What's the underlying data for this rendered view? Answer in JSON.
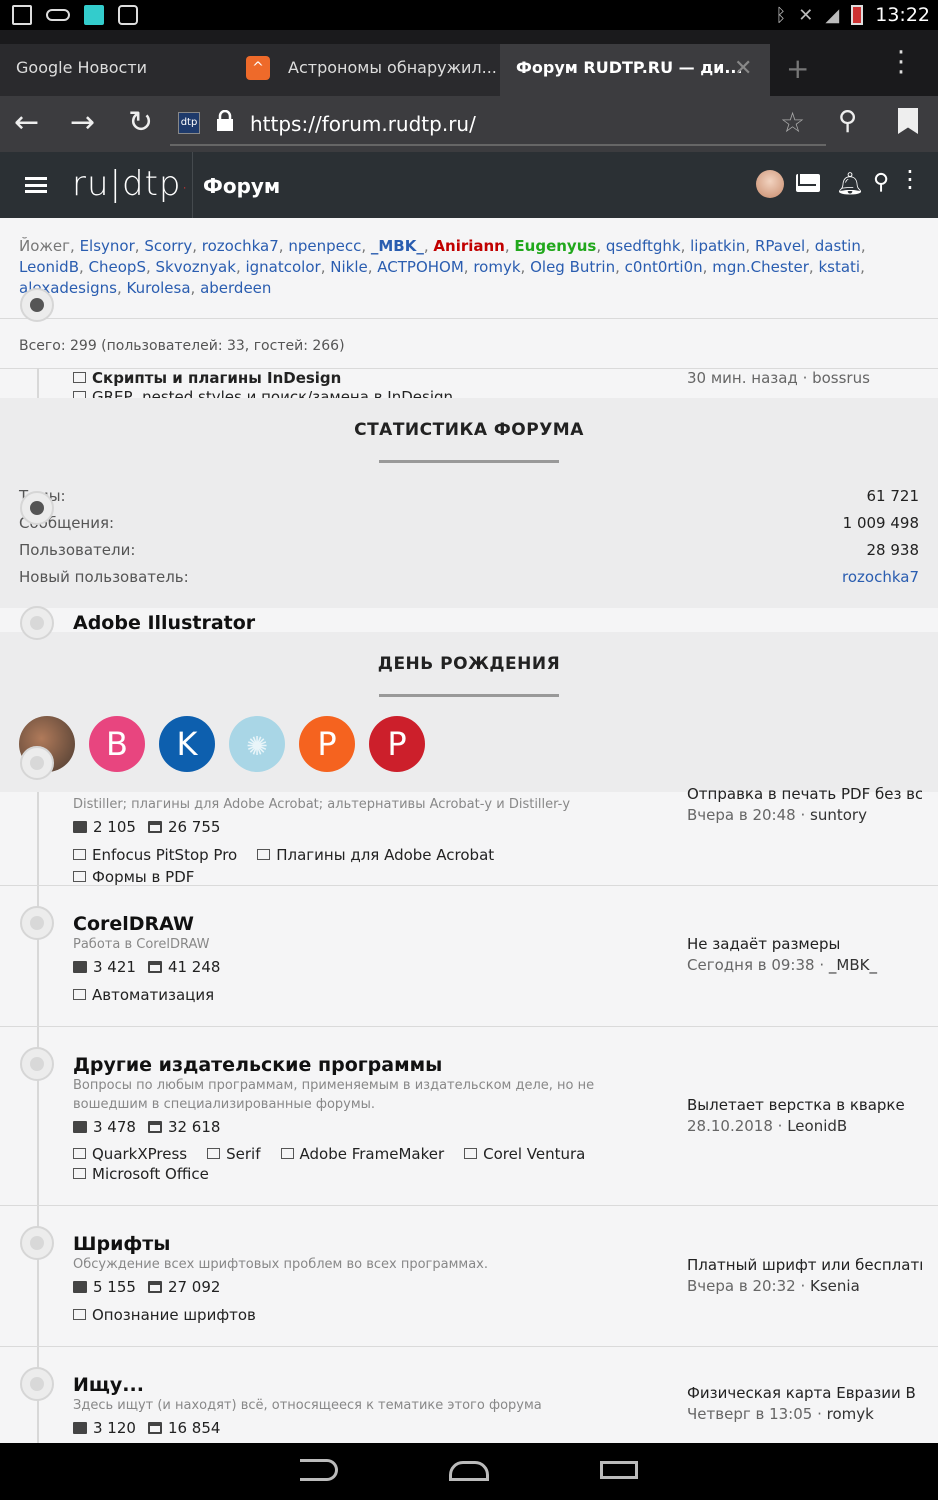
{
  "status_bar": {
    "time": "13:22"
  },
  "browser": {
    "tabs": [
      {
        "label": "Google Новости"
      },
      {
        "label": "Астрономы обнаружил..."
      },
      {
        "label": "Форум RUDTP.RU — ди..."
      }
    ],
    "url": "https://forum.rudtp.ru/"
  },
  "forum_header": {
    "logo_text": "ru|dtp",
    "title": "Форум"
  },
  "online": {
    "users": [
      {
        "name": "Йожег",
        "style": "plain"
      },
      {
        "name": "Elsynor",
        "style": "link"
      },
      {
        "name": "Scorry",
        "style": "link"
      },
      {
        "name": "rozochka7",
        "style": "link"
      },
      {
        "name": "npenpecc",
        "style": "link"
      },
      {
        "name": "_MBK_",
        "style": "mbk"
      },
      {
        "name": "Aniriann",
        "style": "red"
      },
      {
        "name": "Eugenyus",
        "style": "green"
      },
      {
        "name": "qsedftghk",
        "style": "link"
      },
      {
        "name": "lipatkin",
        "style": "link"
      },
      {
        "name": "RPavel",
        "style": "link"
      },
      {
        "name": "dastin",
        "style": "link"
      },
      {
        "name": "LeonidB",
        "style": "link"
      },
      {
        "name": "CheopS",
        "style": "link"
      },
      {
        "name": "Skvoznyak",
        "style": "link"
      },
      {
        "name": "ignatcolor",
        "style": "link"
      },
      {
        "name": "Nikle",
        "style": "link"
      },
      {
        "name": "ACTPOHOM",
        "style": "link"
      },
      {
        "name": "romyk",
        "style": "link"
      },
      {
        "name": "Oleg Butrin",
        "style": "link"
      },
      {
        "name": "c0nt0rti0n",
        "style": "link"
      },
      {
        "name": "mgn.Chester",
        "style": "link"
      },
      {
        "name": "kstati",
        "style": "link"
      },
      {
        "name": "alexadesigns",
        "style": "link"
      },
      {
        "name": "Kurolesa",
        "style": "link"
      },
      {
        "name": "aberdeen",
        "style": "link"
      }
    ],
    "total": "Всего: 299 (пользователей: 33, гостей: 266)"
  },
  "peek": {
    "a_sub": "Скрипты и плагины InDesign",
    "a_sub2": "GREP, nested styles и поиск/замена в InDesign",
    "a_last": "30 мин. назад · bossrus"
  },
  "stats": {
    "title": "СТАТИСТИКА ФОРУМА",
    "rows": [
      {
        "label": "Темы:",
        "value": "61 721"
      },
      {
        "label": "Сообщения:",
        "value": "1 009 498"
      },
      {
        "label": "Пользователи:",
        "value": "28 938"
      },
      {
        "label": "Новый пользователь:",
        "value": "rozochka7"
      }
    ]
  },
  "illustrator_peek": "Adobe Illustrator",
  "birthday": {
    "title": "ДЕНЬ РОЖДЕНИЯ",
    "avatars": [
      {
        "letter": "",
        "color": "#6b5a4e"
      },
      {
        "letter": "B",
        "color": "#e8457f"
      },
      {
        "letter": "K",
        "color": "#0d5fae"
      },
      {
        "letter": "",
        "color": "#a9d6e6"
      },
      {
        "letter": "P",
        "color": "#f5631f"
      },
      {
        "letter": "P",
        "color": "#cc1f2b"
      }
    ]
  },
  "forums": [
    {
      "id": "acrobat",
      "name": "",
      "desc": "Distiller; плагины для Adobe Acrobat; альтернативы Acrobat-у и Distiller-у",
      "threads": "2 105",
      "posts": "26 755",
      "subforums": [
        "Enfocus PitStop Pro",
        "Плагины для Adobe Acrobat",
        "Формы в PDF"
      ],
      "last_title": "Отправка в печать PDF без вс...",
      "last_time": "Вчера в 20:48",
      "last_user": "suntory"
    },
    {
      "id": "coreldraw",
      "name": "CorelDRAW",
      "desc": "Работа в CorelDRAW",
      "threads": "3 421",
      "posts": "41 248",
      "subforums": [
        "Автоматизация"
      ],
      "last_title": "Не задаёт размеры",
      "last_time": "Сегодня в 09:38",
      "last_user": "_MBK_"
    },
    {
      "id": "other",
      "name": "Другие издательские программы",
      "desc": "Вопросы по любым программам, применяемым в издательском деле, но не вошедшим в специализированные форумы.",
      "threads": "3 478",
      "posts": "32 618",
      "subforums": [
        "QuarkXPress",
        "Serif",
        "Adobe FrameMaker",
        "Corel Ventura",
        "Microsoft Office"
      ],
      "last_title": "Вылетает верстка в кварке",
      "last_time": "28.10.2018",
      "last_user": "LeonidB"
    },
    {
      "id": "fonts",
      "name": "Шрифты",
      "desc": "Обсуждение всех шрифтовых проблем во всех программах.",
      "threads": "5 155",
      "posts": "27 092",
      "subforums": [
        "Опознание шрифтов"
      ],
      "last_title": "Платный шрифт или бесплатн...",
      "last_time": "Вчера в 20:32",
      "last_user": "Ksenia"
    },
    {
      "id": "search",
      "name": "Ищу...",
      "desc": "Здесь ищут (и находят) всё, относящееся к тематике этого форума",
      "threads": "3 120",
      "posts": "16 854",
      "subforums": [],
      "last_title": "Физическая карта Евразии В ...",
      "last_time": "Четверг в 13:05",
      "last_user": "romyk"
    }
  ]
}
